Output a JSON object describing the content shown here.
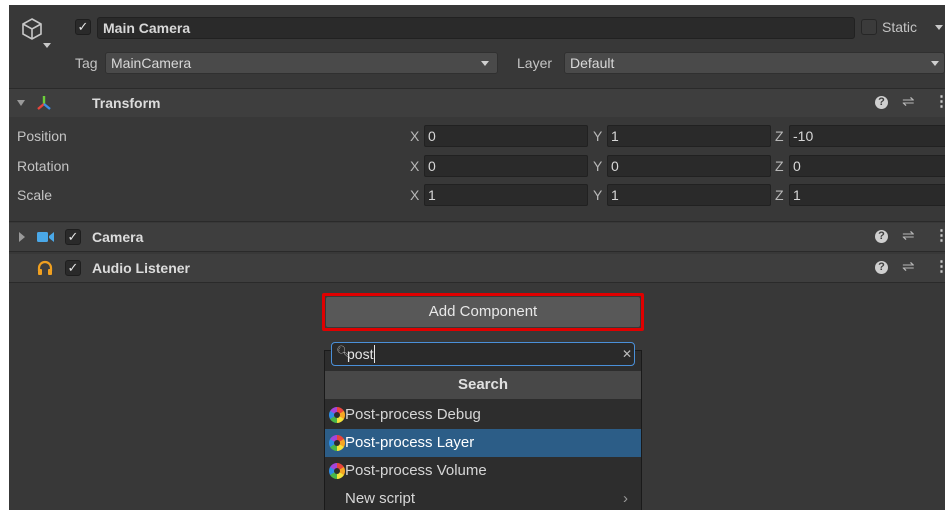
{
  "gameobject": {
    "name": "Main Camera",
    "static_label": "Static",
    "tag_label": "Tag",
    "tag_value": "MainCamera",
    "layer_label": "Layer",
    "layer_value": "Default"
  },
  "transform": {
    "title": "Transform",
    "rows": [
      {
        "label": "Position",
        "x": "0",
        "y": "1",
        "z": "-10"
      },
      {
        "label": "Rotation",
        "x": "0",
        "y": "0",
        "z": "0"
      },
      {
        "label": "Scale",
        "x": "1",
        "y": "1",
        "z": "1"
      }
    ],
    "axis_x": "X",
    "axis_y": "Y",
    "axis_z": "Z"
  },
  "components": {
    "camera": "Camera",
    "audio_listener": "Audio Listener"
  },
  "add_component": {
    "button_label": "Add Component",
    "search_value": "post",
    "section_header": "Search",
    "items": [
      {
        "label": "Post-process Debug",
        "selected": false
      },
      {
        "label": "Post-process Layer",
        "selected": true
      },
      {
        "label": "Post-process Volume",
        "selected": false
      }
    ],
    "new_script_label": "New script"
  },
  "colors": {
    "panel_bg": "#383838",
    "selection": "#2c5d87",
    "highlight_outline": "#e00000",
    "camera_icon": "#4aa8e8",
    "audio_icon": "#f0a020"
  }
}
